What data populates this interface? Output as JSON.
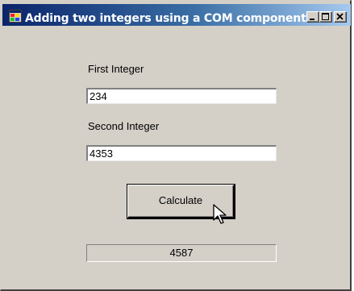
{
  "window": {
    "title": "Adding two integers using a COM component",
    "icon": "app-form-icon",
    "controls": {
      "minimize_icon": "minimize-icon",
      "maximize_icon": "maximize-icon",
      "close_icon": "close-icon"
    }
  },
  "form": {
    "first_label": "First Integer",
    "first_value": "234",
    "second_label": "Second Integer",
    "second_value": "4353",
    "calculate_label": "Calculate",
    "result_value": "4587"
  },
  "colors": {
    "titlebar_start": "#0a246a",
    "titlebar_end": "#a6caf0",
    "window_bg": "#d4d0c8"
  }
}
